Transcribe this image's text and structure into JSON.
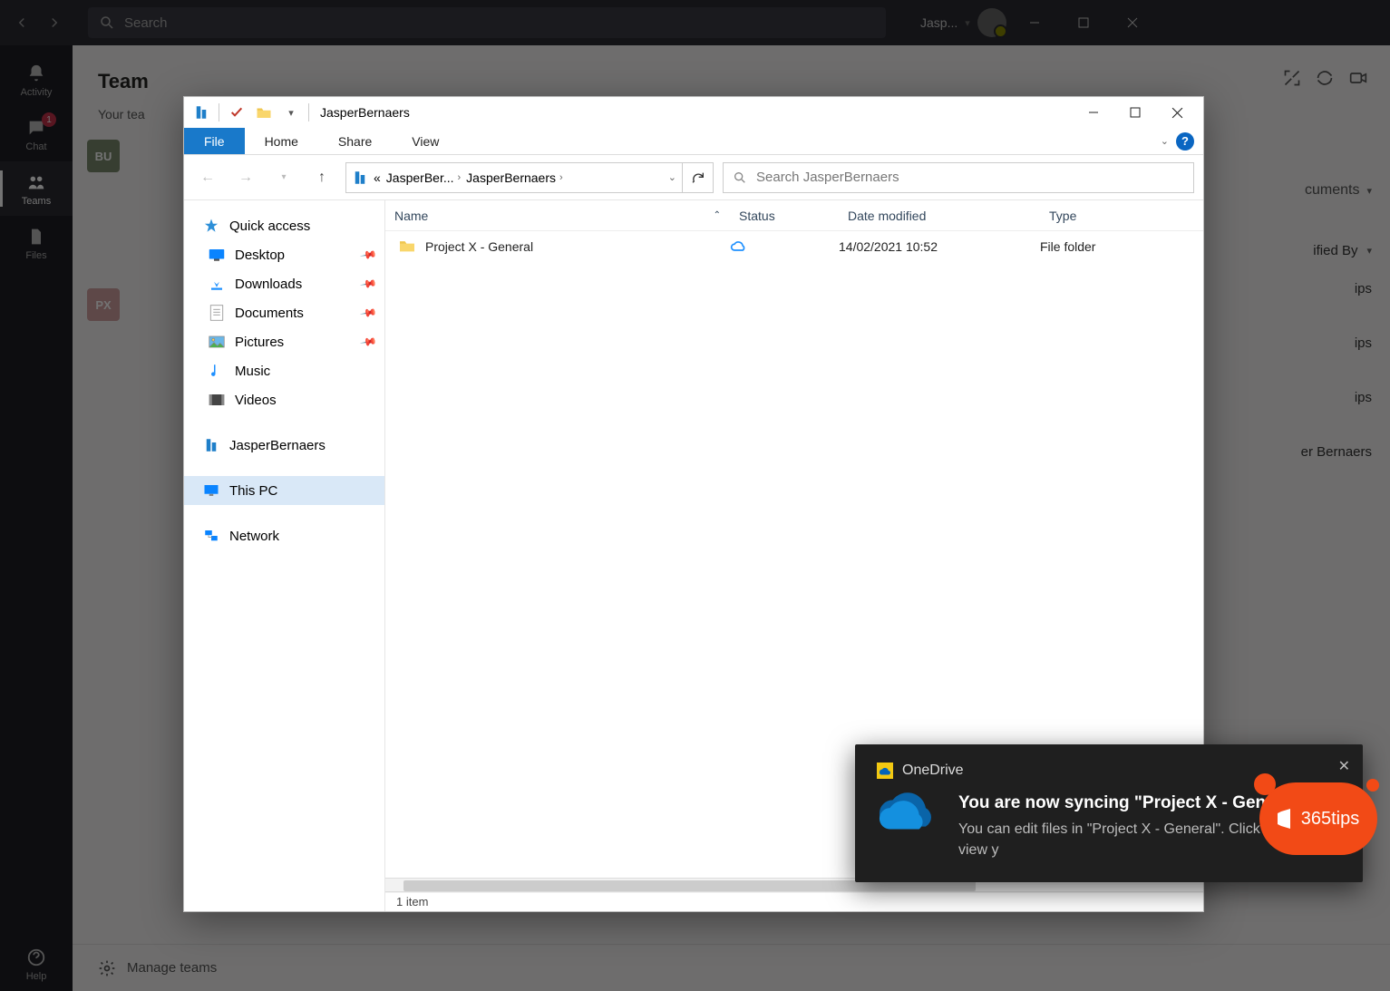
{
  "teams": {
    "search_placeholder": "Search",
    "user_label": "Jasp...",
    "header": "Team",
    "subheader": "Your tea",
    "rail": [
      {
        "label": "Activity",
        "id": "activity"
      },
      {
        "label": "Chat",
        "id": "chat",
        "badge": "1"
      },
      {
        "label": "Teams",
        "id": "teams",
        "selected": true
      },
      {
        "label": "Files",
        "id": "files"
      }
    ],
    "help_label": "Help",
    "team_tiles": [
      {
        "initials": "BU",
        "cls": "bu"
      },
      {
        "initials": "PX",
        "cls": "px"
      }
    ],
    "right_panel": {
      "documents_label": "cuments",
      "modified_by": "ified By",
      "rows": [
        "ips",
        "ips",
        "ips",
        "er Bernaers"
      ]
    },
    "manage_label": "Manage teams"
  },
  "explorer": {
    "window_title": "JasperBernaers",
    "tabs": {
      "file": "File",
      "home": "Home",
      "share": "Share",
      "view": "View"
    },
    "breadcrumb": [
      "JasperBer...",
      "JasperBernaers"
    ],
    "breadcrumb_prefix": "«",
    "search_placeholder": "Search JasperBernaers",
    "nav": {
      "quick_access": "Quick access",
      "desktop": "Desktop",
      "downloads": "Downloads",
      "documents": "Documents",
      "pictures": "Pictures",
      "music": "Music",
      "videos": "Videos",
      "jasper": "JasperBernaers",
      "this_pc": "This PC",
      "network": "Network"
    },
    "columns": {
      "name": "Name",
      "status": "Status",
      "date": "Date modified",
      "type": "Type"
    },
    "rows": [
      {
        "name": "Project X - General",
        "date": "14/02/2021 10:52",
        "type": "File folder"
      }
    ],
    "status_text": "1 item"
  },
  "toast": {
    "app": "OneDrive",
    "title": "You are now syncing \"Project X - General\"",
    "subtitle": "You can edit files in \"Project X - General\". Click here to view y"
  },
  "tipsbubble": {
    "text": "365tips"
  }
}
